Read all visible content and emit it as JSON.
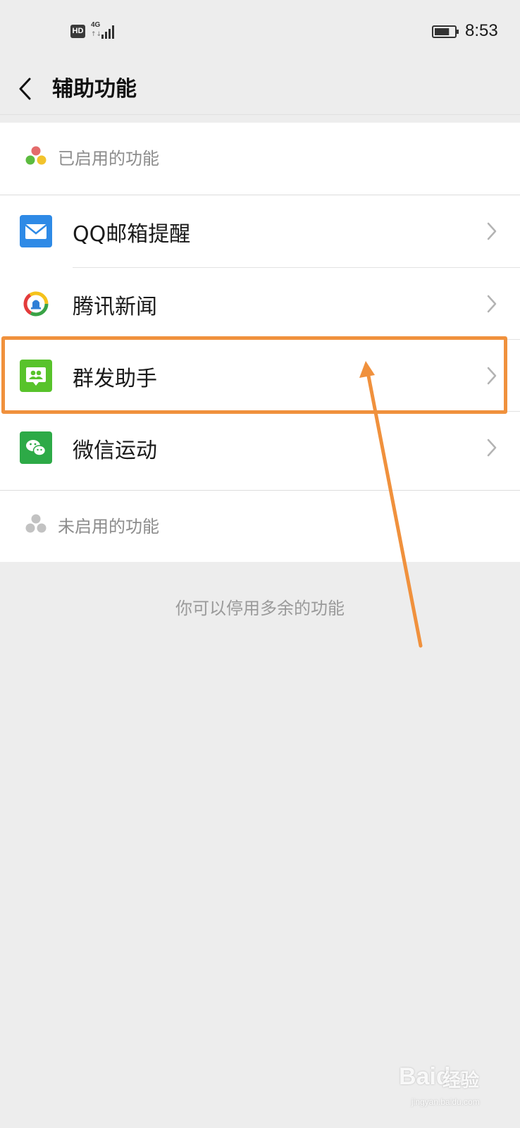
{
  "status_bar": {
    "hd_badge": "HD",
    "network": "4G",
    "network_arrows": "↑↓",
    "time": "8:53",
    "battery_level": 0.75
  },
  "nav": {
    "title": "辅助功能",
    "back_icon": "chevron-left-icon"
  },
  "enabled_section": {
    "label": "已启用的功能",
    "items": [
      {
        "label": "QQ邮箱提醒",
        "icon": "mail-icon",
        "icon_color": "#2e8ae6"
      },
      {
        "label": "腾讯新闻",
        "icon": "tencent-news-icon",
        "icon_color": "#ffffff"
      },
      {
        "label": "群发助手",
        "icon": "mass-message-icon",
        "icon_color": "#58c32b"
      },
      {
        "label": "微信运动",
        "icon": "wechat-sport-icon",
        "icon_color": "#2daa47"
      }
    ]
  },
  "disabled_section": {
    "label": "未启用的功能"
  },
  "footer_note": "你可以停用多余的功能",
  "annotation": {
    "highlight_color": "#f0913d",
    "highlighted_item": "群发助手"
  },
  "watermark": {
    "brand": "Bai",
    "brand_suffix": "du",
    "cn": "经验",
    "url": "jingyan.baidu.com"
  },
  "colors": {
    "background": "#ededed",
    "card": "#ffffff",
    "section_text": "#8c8c8c"
  }
}
